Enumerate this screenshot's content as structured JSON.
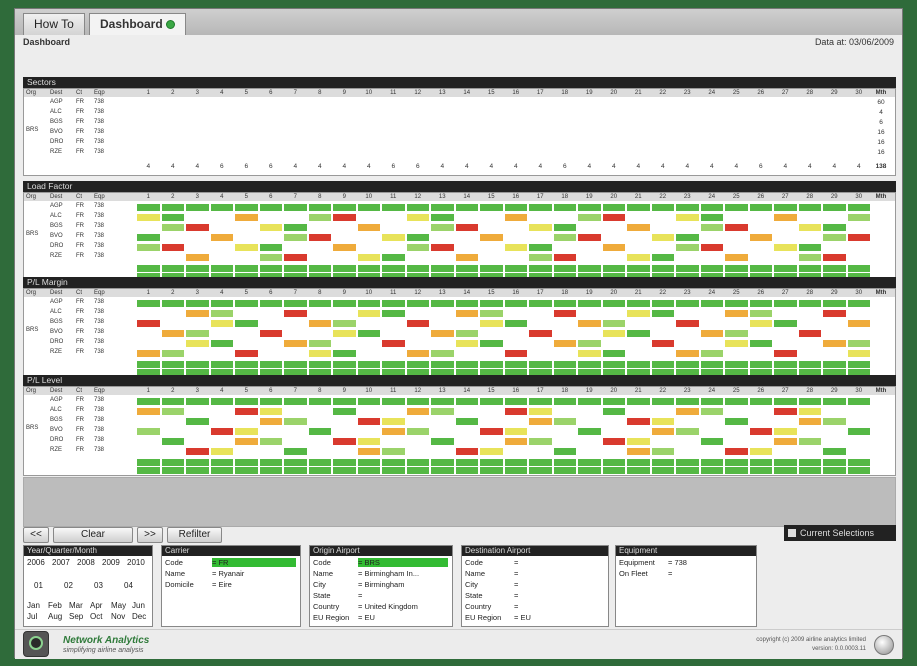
{
  "tabs": [
    {
      "label": "How To"
    },
    {
      "label": "Dashboard"
    }
  ],
  "breadcrumb": "Dashboard",
  "data_at": "Data at: 03/06/2009",
  "grid_header": {
    "org": "Org",
    "dest": "Dest",
    "ct": "Ct",
    "eqp": "Eqp",
    "mth": "Mth"
  },
  "days": [
    "1",
    "2",
    "3",
    "4",
    "5",
    "6",
    "7",
    "8",
    "9",
    "10",
    "11",
    "12",
    "13",
    "14",
    "15",
    "16",
    "17",
    "18",
    "19",
    "20",
    "21",
    "22",
    "23",
    "24",
    "25",
    "26",
    "27",
    "28",
    "29",
    "30"
  ],
  "origin": "BRS",
  "routes": [
    {
      "dest": "AGP",
      "ct": "FR",
      "eqp": "738"
    },
    {
      "dest": "ALC",
      "ct": "FR",
      "eqp": "738"
    },
    {
      "dest": "BGS",
      "ct": "FR",
      "eqp": "738"
    },
    {
      "dest": "BVO",
      "ct": "FR",
      "eqp": "738"
    },
    {
      "dest": "DRO",
      "ct": "FR",
      "eqp": "738"
    },
    {
      "dest": "RZE",
      "ct": "FR",
      "eqp": "738"
    }
  ],
  "sections": [
    {
      "title": "Sectors"
    },
    {
      "title": "Load Factor"
    },
    {
      "title": "P/L Margin"
    },
    {
      "title": "P/L Level"
    }
  ],
  "sectors_totals": [
    "4",
    "4",
    "4",
    "6",
    "6",
    "6",
    "4",
    "4",
    "4",
    "4",
    "6",
    "6",
    "4",
    "4",
    "4",
    "4",
    "4",
    "6",
    "4",
    "4",
    "4",
    "4",
    "4",
    "4",
    "4",
    "6",
    "4",
    "4",
    "4",
    "4"
  ],
  "sectors_total_mth": "138",
  "sectors_row_totals": [
    "60",
    "4",
    "6",
    "16",
    "16",
    "16"
  ],
  "colors": {
    "green": "#55b845",
    "light_green": "#9bd36a",
    "yellow": "#e8e35a",
    "orange": "#efab3b",
    "red": "#d93a2e",
    "accent": "#3aa744"
  },
  "controls": {
    "prev": "<<",
    "clear": "Clear",
    "next": ">>",
    "refresh": "Refilter",
    "current_selections": "Current Selections"
  },
  "year_panel": {
    "title": "Year/Quarter/Month",
    "years": [
      "2006",
      "2007",
      "2008",
      "2009",
      "2010"
    ],
    "quarters": [
      "01",
      "02",
      "03",
      "04"
    ],
    "months_row1": [
      "Jan",
      "Feb",
      "Mar",
      "Apr",
      "May",
      "Jun"
    ],
    "months_row2": [
      "Jul",
      "Aug",
      "Sep",
      "Oct",
      "Nov",
      "Dec"
    ]
  },
  "carrier_panel": {
    "title": "Carrier",
    "rows": [
      {
        "label": "Code",
        "value": "= FR"
      },
      {
        "label": "Name",
        "value": "= Ryanair"
      },
      {
        "label": "Domicile",
        "value": "= Eire"
      }
    ]
  },
  "origin_panel": {
    "title": "Origin Airport",
    "rows": [
      {
        "label": "Code",
        "value": "= BRS"
      },
      {
        "label": "Name",
        "value": "= Birmingham In..."
      },
      {
        "label": "City",
        "value": "= Birmingham"
      },
      {
        "label": "State",
        "value": "="
      },
      {
        "label": "Country",
        "value": "= United Kingdom"
      },
      {
        "label": "EU Region",
        "value": "= EU"
      }
    ]
  },
  "dest_panel": {
    "title": "Destination Airport",
    "rows": [
      {
        "label": "Code",
        "value": "="
      },
      {
        "label": "Name",
        "value": "="
      },
      {
        "label": "City",
        "value": "="
      },
      {
        "label": "State",
        "value": "="
      },
      {
        "label": "Country",
        "value": "="
      },
      {
        "label": "EU Region",
        "value": "= EU"
      }
    ]
  },
  "equipment_panel": {
    "title": "Equipment",
    "rows": [
      {
        "label": "Equipment",
        "value": "= 738"
      },
      {
        "label": "On Fleet",
        "value": "="
      }
    ]
  },
  "footer": {
    "brand": "Network Analytics",
    "tagline": "simplifying airline analysis",
    "copyright": "copyright (c) 2009 airline analytics limited",
    "version": "version: 0.0.0003.11"
  }
}
